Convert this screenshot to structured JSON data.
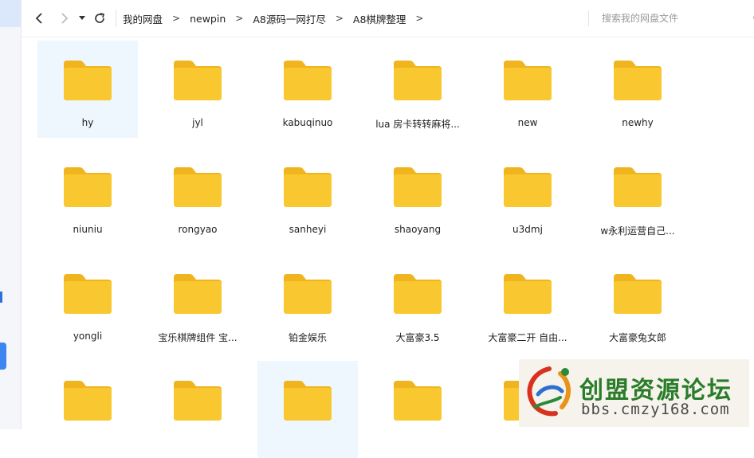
{
  "nav": {
    "back_icon": "chevron-left-icon",
    "forward_icon": "chevron-right-icon",
    "dropdown_icon": "caret-down-icon",
    "refresh_icon": "refresh-icon",
    "breadcrumbs": [
      "我的网盘",
      "newpin",
      "A8源码一网打尽",
      "A8棋牌整理"
    ],
    "separator": ">"
  },
  "search": {
    "placeholder": "搜索我的网盘文件",
    "icon": "search-icon"
  },
  "colors": {
    "folder": "#F9C830",
    "folder_tab": "#F0B51E",
    "selected_bg": "#EEF6FE",
    "accent": "#2E6FE0"
  },
  "files": [
    {
      "name": "hy",
      "highlighted": true
    },
    {
      "name": "jyl"
    },
    {
      "name": "kabuqinuo"
    },
    {
      "name": "lua 房卡转转麻将..."
    },
    {
      "name": "new"
    },
    {
      "name": "newhy"
    },
    {
      "name": "niuniu"
    },
    {
      "name": "rongyao"
    },
    {
      "name": "sanheyi"
    },
    {
      "name": "shaoyang"
    },
    {
      "name": "u3dmj"
    },
    {
      "name": "w永利运营自己..."
    },
    {
      "name": "yongli"
    },
    {
      "name": "宝乐棋牌组件 宝..."
    },
    {
      "name": "铂金娱乐"
    },
    {
      "name": "大富豪3.5"
    },
    {
      "name": "大富豪二开 自由..."
    },
    {
      "name": "大富豪兔女郎"
    },
    {
      "name": ""
    },
    {
      "name": ""
    },
    {
      "name": "",
      "highlighted": true
    },
    {
      "name": ""
    },
    {
      "name": ""
    }
  ],
  "watermark": {
    "title": "创盟资源论坛",
    "url": "bbs.cmzy168.com"
  }
}
